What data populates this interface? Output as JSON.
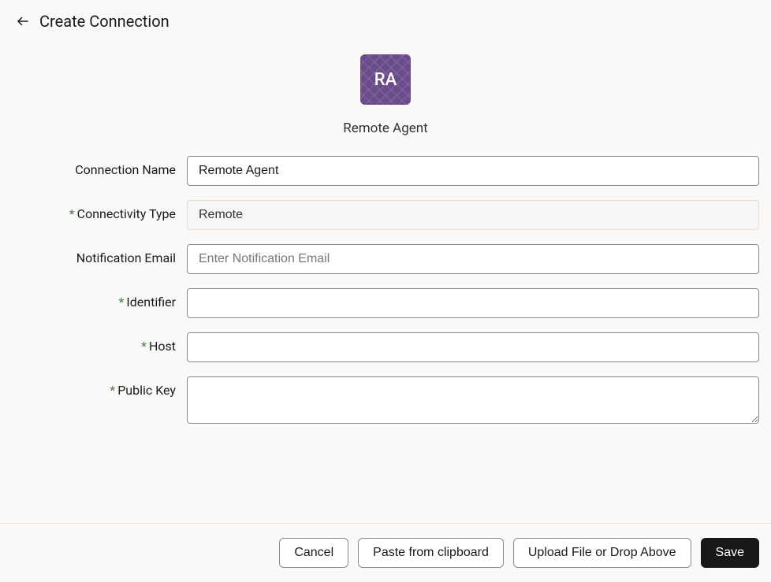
{
  "header": {
    "title": "Create Connection"
  },
  "agent": {
    "icon_text": "RA",
    "label": "Remote Agent"
  },
  "form": {
    "connection_name": {
      "label": "Connection Name",
      "value": "Remote Agent",
      "required": false
    },
    "connectivity_type": {
      "label": "Connectivity Type",
      "value": "Remote",
      "required": true
    },
    "notification_email": {
      "label": "Notification Email",
      "placeholder": "Enter Notification Email",
      "value": "",
      "required": false
    },
    "identifier": {
      "label": "Identifier",
      "value": "",
      "required": true
    },
    "host": {
      "label": "Host",
      "value": "",
      "required": true
    },
    "public_key": {
      "label": "Public Key",
      "value": "",
      "required": true
    }
  },
  "footer": {
    "cancel": "Cancel",
    "paste": "Paste from clipboard",
    "upload": "Upload File or Drop Above",
    "save": "Save"
  }
}
